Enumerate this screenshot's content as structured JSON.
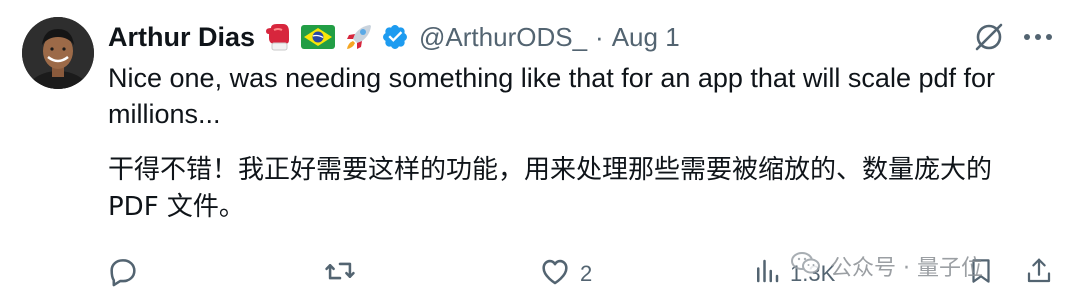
{
  "author": {
    "name": "Arthur Dias",
    "handle": "@ArthurODS_",
    "emojis": [
      "boxing-glove",
      "brazil-flag",
      "rocket"
    ],
    "verified": true
  },
  "meta": {
    "separator": "·",
    "date": "Aug 1"
  },
  "content": {
    "text_en": "Nice one, was needing something like that for an app that will scale pdf for millions...",
    "text_zh": "干得不错！我正好需要这样的功能，用来处理那些需要被缩放的、数量庞大的PDF 文件。"
  },
  "actions": {
    "replies": {
      "icon": "reply-icon",
      "count": ""
    },
    "reposts": {
      "icon": "repost-icon",
      "count": ""
    },
    "likes": {
      "icon": "like-icon",
      "count": "2"
    },
    "views": {
      "icon": "views-icon",
      "count": "1.3K"
    },
    "bookmark": {
      "icon": "bookmark-icon"
    },
    "share": {
      "icon": "share-icon"
    }
  },
  "watermark": {
    "text": "公众号 · 量子位"
  },
  "colors": {
    "text": "#0f1419",
    "muted": "#536471",
    "verified": "#1d9bf0"
  }
}
